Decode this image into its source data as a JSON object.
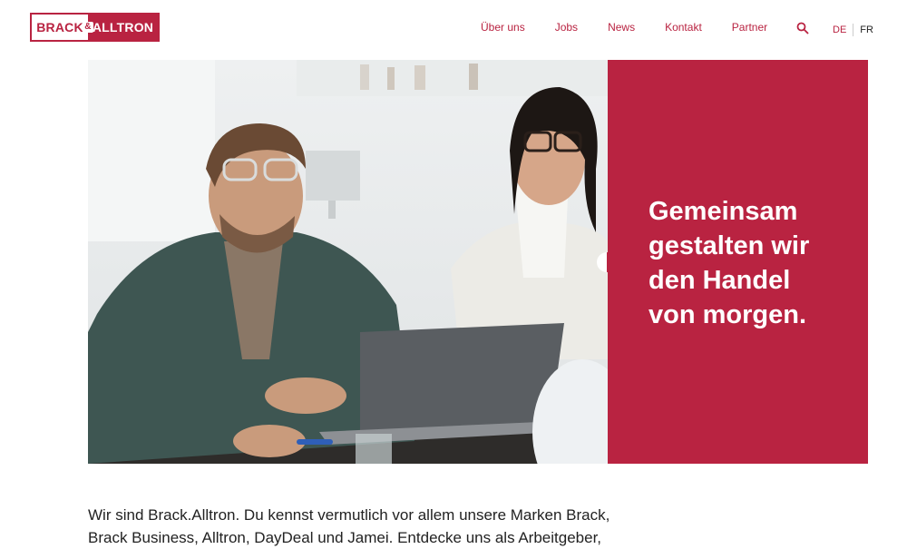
{
  "header": {
    "logo": {
      "left": "BRACK",
      "amp": "&",
      "right": "ALLTRON"
    },
    "nav": [
      "Über uns",
      "Jobs",
      "News",
      "Kontakt",
      "Partner"
    ],
    "lang": {
      "de": "DE",
      "fr": "FR"
    }
  },
  "hero": {
    "title": "Gemeinsam\ngestalten wir\nden Handel\nvon morgen."
  },
  "intro": {
    "lines": [
      "Wir sind Brack.Alltron. Du kennst vermutlich vor allem unsere Marken Brack,",
      "Brack Business, Alltron, DayDeal und Jamei. Entdecke uns als Arbeitgeber,"
    ]
  },
  "colors": {
    "brand": "#b92341",
    "text": "#222222"
  },
  "icons": {
    "search": "search-icon"
  }
}
